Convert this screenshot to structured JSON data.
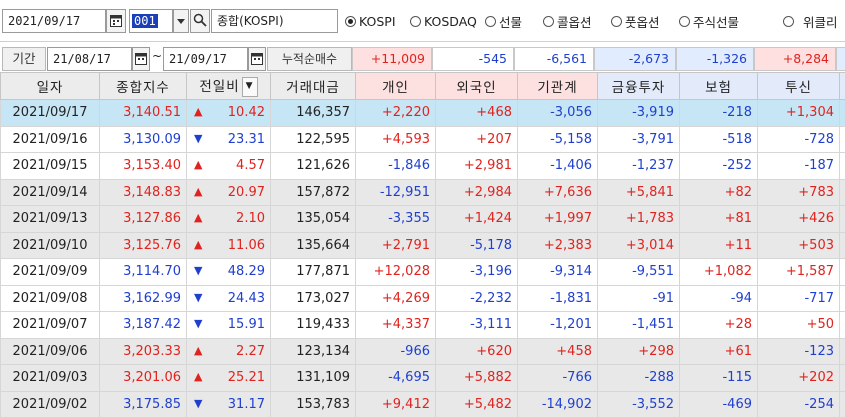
{
  "toolbar": {
    "date": "2021/09/17",
    "code": "001",
    "market_name": "종합(KOSPI)",
    "radios": [
      {
        "label": "KOSPI",
        "selected": true
      },
      {
        "label": "KOSDAQ",
        "selected": false
      },
      {
        "label": "선물",
        "selected": false
      },
      {
        "label": "콜옵션",
        "selected": false
      },
      {
        "label": "풋옵션",
        "selected": false
      },
      {
        "label": "주식선물",
        "selected": false
      },
      {
        "label": "위클리",
        "selected": false
      }
    ]
  },
  "period": {
    "label": "기간",
    "from": "21/08/17",
    "to": "21/09/17",
    "sep": "~",
    "cumulative_label": "누적순매수",
    "cumulative": [
      "+11,009",
      "-545",
      "-6,561",
      "-2,673",
      "-1,326",
      "+8,284"
    ]
  },
  "table": {
    "headers": [
      "일자",
      "종합지수",
      "전일비",
      "거래대금",
      "개인",
      "외국인",
      "기관계",
      "금융투자",
      "보험",
      "투신"
    ],
    "rows": [
      {
        "date": "2021/09/17",
        "index": "3,140.51",
        "dir": "up",
        "change": "10.42",
        "volume": "146,357",
        "ind": "+2,220",
        "for": "+468",
        "inst": "-3,056",
        "fin": "-3,919",
        "ins": "-218",
        "trust": "+1,304"
      },
      {
        "date": "2021/09/16",
        "index": "3,130.09",
        "dir": "down",
        "change": "23.31",
        "volume": "122,595",
        "ind": "+4,593",
        "for": "+207",
        "inst": "-5,158",
        "fin": "-3,791",
        "ins": "-518",
        "trust": "-728"
      },
      {
        "date": "2021/09/15",
        "index": "3,153.40",
        "dir": "up",
        "change": "4.57",
        "volume": "121,626",
        "ind": "-1,846",
        "for": "+2,981",
        "inst": "-1,406",
        "fin": "-1,237",
        "ins": "-252",
        "trust": "-187"
      },
      {
        "date": "2021/09/14",
        "index": "3,148.83",
        "dir": "up",
        "change": "20.97",
        "volume": "157,872",
        "ind": "-12,951",
        "for": "+2,984",
        "inst": "+7,636",
        "fin": "+5,841",
        "ins": "+82",
        "trust": "+783"
      },
      {
        "date": "2021/09/13",
        "index": "3,127.86",
        "dir": "up",
        "change": "2.10",
        "volume": "135,054",
        "ind": "-3,355",
        "for": "+1,424",
        "inst": "+1,997",
        "fin": "+1,783",
        "ins": "+81",
        "trust": "+426"
      },
      {
        "date": "2021/09/10",
        "index": "3,125.76",
        "dir": "up",
        "change": "11.06",
        "volume": "135,664",
        "ind": "+2,791",
        "for": "-5,178",
        "inst": "+2,383",
        "fin": "+3,014",
        "ins": "+11",
        "trust": "+503"
      },
      {
        "date": "2021/09/09",
        "index": "3,114.70",
        "dir": "down",
        "change": "48.29",
        "volume": "177,871",
        "ind": "+12,028",
        "for": "-3,196",
        "inst": "-9,314",
        "fin": "-9,551",
        "ins": "+1,082",
        "trust": "+1,587"
      },
      {
        "date": "2021/09/08",
        "index": "3,162.99",
        "dir": "down",
        "change": "24.43",
        "volume": "173,027",
        "ind": "+4,269",
        "for": "-2,232",
        "inst": "-1,831",
        "fin": "-91",
        "ins": "-94",
        "trust": "-717"
      },
      {
        "date": "2021/09/07",
        "index": "3,187.42",
        "dir": "down",
        "change": "15.91",
        "volume": "119,433",
        "ind": "+4,337",
        "for": "-3,111",
        "inst": "-1,201",
        "fin": "-1,451",
        "ins": "+28",
        "trust": "+50"
      },
      {
        "date": "2021/09/06",
        "index": "3,203.33",
        "dir": "up",
        "change": "2.27",
        "volume": "123,134",
        "ind": "-966",
        "for": "+620",
        "inst": "+458",
        "fin": "+298",
        "ins": "+61",
        "trust": "-123"
      },
      {
        "date": "2021/09/03",
        "index": "3,201.06",
        "dir": "up",
        "change": "25.21",
        "volume": "131,109",
        "ind": "-4,695",
        "for": "+5,882",
        "inst": "-766",
        "fin": "-288",
        "ins": "-115",
        "trust": "+202"
      },
      {
        "date": "2021/09/02",
        "index": "3,175.85",
        "dir": "down",
        "change": "31.17",
        "volume": "153,783",
        "ind": "+9,412",
        "for": "+5,482",
        "inst": "-14,902",
        "fin": "-3,552",
        "ins": "-469",
        "trust": "-254"
      }
    ]
  },
  "colors": {
    "positive": "#e0231e",
    "negative": "#1f3fcf",
    "selected_row": "#c7e6f5",
    "gray_row": "#e8e8e8"
  }
}
